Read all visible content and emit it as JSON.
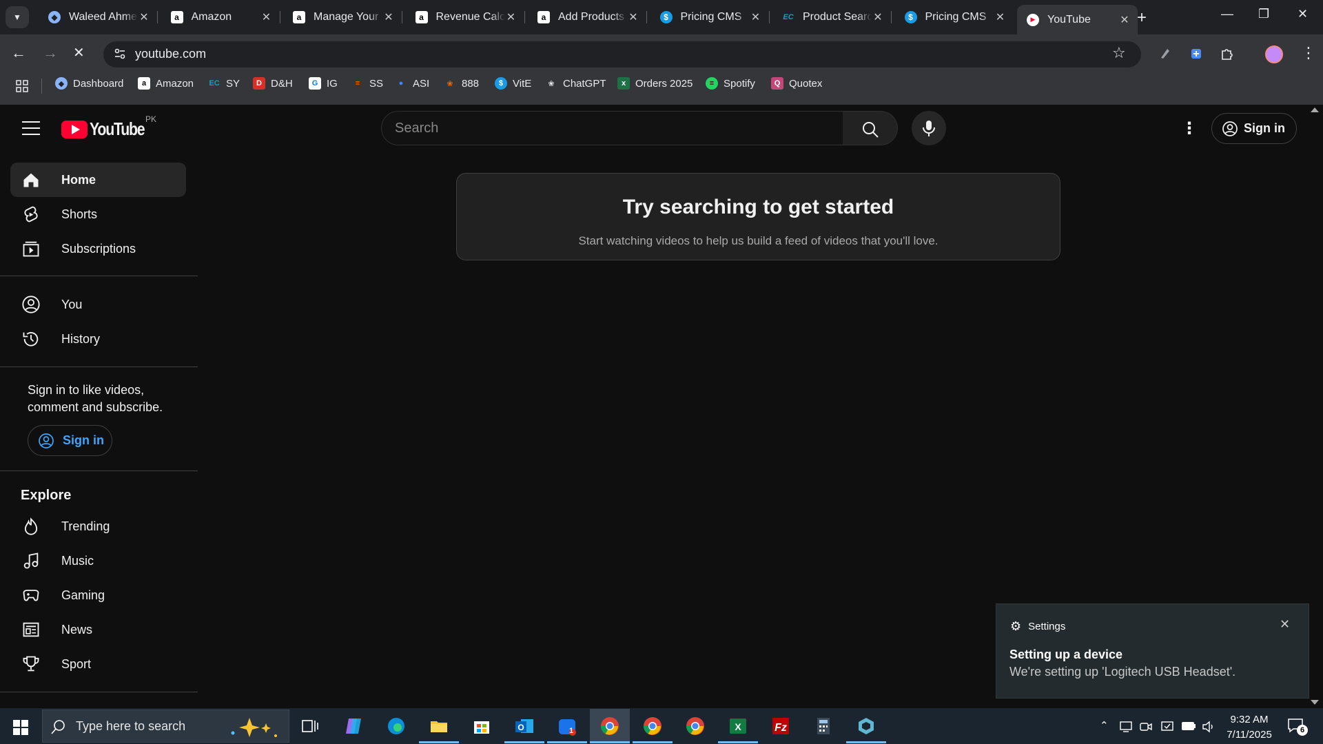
{
  "browser": {
    "tabs": [
      {
        "title": "Waleed Ahmed",
        "favicon": "globe-icon",
        "color": "#8ab4f8"
      },
      {
        "title": "Amazon",
        "favicon": "amazon-icon",
        "color": "#ffffff"
      },
      {
        "title": "Manage Your",
        "favicon": "amazon-icon",
        "color": "#ffffff"
      },
      {
        "title": "Revenue Calc",
        "favicon": "amazon-icon",
        "color": "#ffffff"
      },
      {
        "title": "Add Products",
        "favicon": "amazon-icon",
        "color": "#ffffff"
      },
      {
        "title": "Pricing CMS",
        "favicon": "dollar-icon",
        "color": "#1a9be6"
      },
      {
        "title": "Product Search",
        "favicon": "ec-icon",
        "color": "#0aa3c2"
      },
      {
        "title": "Pricing CMS",
        "favicon": "dollar-icon",
        "color": "#1a9be6"
      },
      {
        "title": "YouTube",
        "favicon": "youtube-icon",
        "color": "#ff0033"
      }
    ],
    "active_tab_index": 8,
    "url": "youtube.com",
    "bookmarks": [
      {
        "label": "Dashboard",
        "icon": "globe-icon"
      },
      {
        "label": "Amazon",
        "icon": "amazon-icon"
      },
      {
        "label": "SY",
        "icon": "ec-icon"
      },
      {
        "label": "D&H",
        "icon": "dh-icon"
      },
      {
        "label": "IG",
        "icon": "ig-icon"
      },
      {
        "label": "SS",
        "icon": "ss-icon"
      },
      {
        "label": "ASI",
        "icon": "asi-icon"
      },
      {
        "label": "888",
        "icon": "888-icon"
      },
      {
        "label": "VitE",
        "icon": "dollar-icon"
      },
      {
        "label": "ChatGPT",
        "icon": "chatgpt-icon"
      },
      {
        "label": "Orders 2025",
        "icon": "excel-icon"
      },
      {
        "label": "Spotify",
        "icon": "spotify-icon"
      },
      {
        "label": "Quotex",
        "icon": "quotex-icon"
      }
    ]
  },
  "youtube": {
    "logo_text": "YouTube",
    "country_code": "PK",
    "search_placeholder": "Search",
    "sign_in": "Sign in",
    "nav_primary": [
      {
        "label": "Home",
        "icon": "home-icon"
      },
      {
        "label": "Shorts",
        "icon": "shorts-icon"
      },
      {
        "label": "Subscriptions",
        "icon": "subscriptions-icon"
      }
    ],
    "nav_you": [
      {
        "label": "You",
        "icon": "account-icon"
      },
      {
        "label": "History",
        "icon": "history-icon"
      }
    ],
    "signin_prompt": "Sign in to like videos, comment and subscribe.",
    "explore_heading": "Explore",
    "nav_explore": [
      {
        "label": "Trending",
        "icon": "trending-icon"
      },
      {
        "label": "Music",
        "icon": "music-icon"
      },
      {
        "label": "Gaming",
        "icon": "gaming-icon"
      },
      {
        "label": "News",
        "icon": "news-icon"
      },
      {
        "label": "Sport",
        "icon": "trophy-icon"
      }
    ],
    "empty_state": {
      "title": "Try searching to get started",
      "subtitle": "Start watching videos to help us build a feed of videos that you'll love."
    }
  },
  "toast": {
    "app": "Settings",
    "title": "Setting up a device",
    "body": "We're setting up 'Logitech USB Headset'."
  },
  "taskbar": {
    "search_placeholder": "Type here to search",
    "time": "9:32 AM",
    "date": "7/11/2025",
    "notification_count": "6",
    "outlook_badge": "1"
  }
}
